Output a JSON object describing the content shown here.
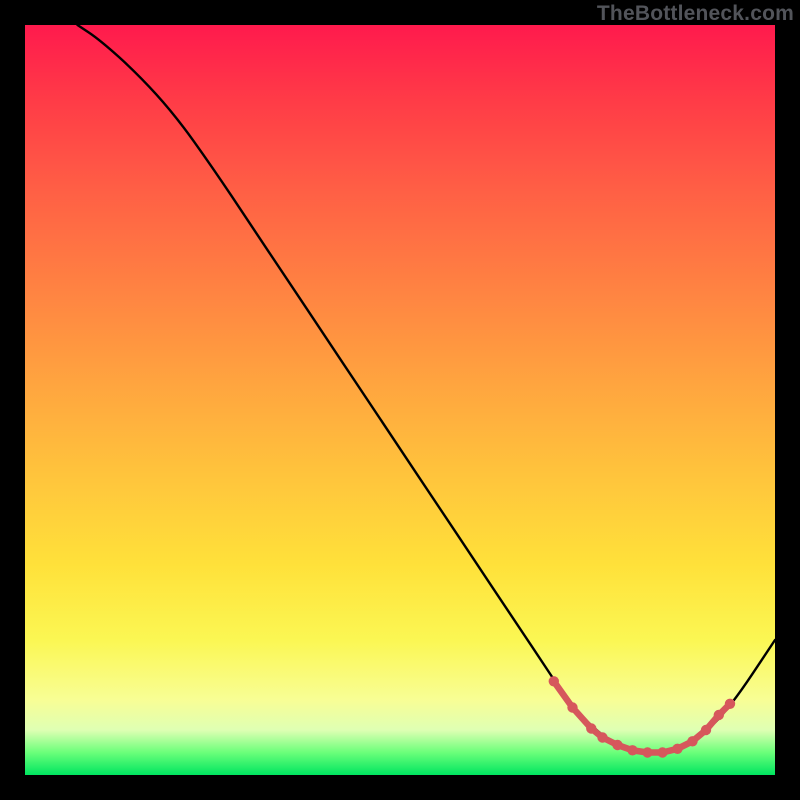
{
  "watermark": "TheBottleneck.com",
  "chart_data": {
    "type": "line",
    "title": "",
    "xlabel": "",
    "ylabel": "",
    "xlim": [
      0,
      100
    ],
    "ylim": [
      0,
      100
    ],
    "series": [
      {
        "name": "bottleneck-curve",
        "x": [
          7,
          10,
          15,
          20,
          25,
          30,
          35,
          40,
          45,
          50,
          55,
          60,
          65,
          70,
          72,
          75,
          78,
          82,
          86,
          90,
          94,
          100
        ],
        "y": [
          100,
          98,
          93.5,
          88,
          81,
          73.5,
          66,
          58.5,
          51,
          43.5,
          36,
          28.5,
          21,
          13.5,
          10.5,
          7,
          4.5,
          3,
          3,
          5,
          9,
          18
        ],
        "color": "#000000",
        "width": 2.4
      }
    ],
    "markers": {
      "name": "optimal-range",
      "color": "#d6575c",
      "radius": 5.2,
      "stroke_width": 6.5,
      "points": [
        {
          "x": 70.5,
          "y": 12.5
        },
        {
          "x": 73.0,
          "y": 9.0
        },
        {
          "x": 75.5,
          "y": 6.2
        },
        {
          "x": 77.0,
          "y": 5.0
        },
        {
          "x": 79.0,
          "y": 4.0
        },
        {
          "x": 81.0,
          "y": 3.3
        },
        {
          "x": 83.0,
          "y": 3.0
        },
        {
          "x": 85.0,
          "y": 3.0
        },
        {
          "x": 87.0,
          "y": 3.5
        },
        {
          "x": 89.0,
          "y": 4.5
        },
        {
          "x": 90.8,
          "y": 6.0
        },
        {
          "x": 92.5,
          "y": 8.0
        },
        {
          "x": 94.0,
          "y": 9.5
        }
      ]
    }
  }
}
